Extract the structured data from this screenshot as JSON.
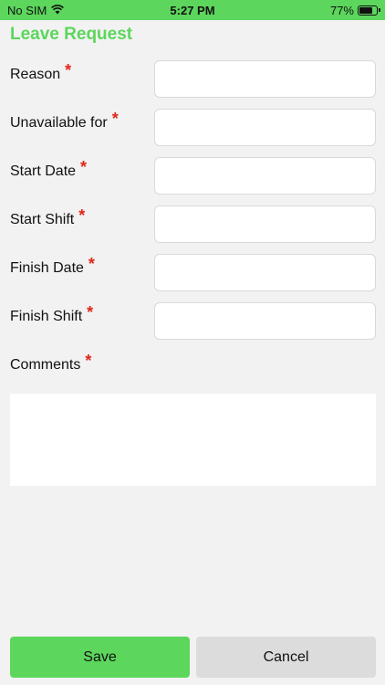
{
  "status_bar": {
    "carrier": "No SIM",
    "time": "5:27 PM",
    "battery_percent": "77%",
    "battery_level": 0.77,
    "wifi_icon": "wifi-icon",
    "battery_icon": "battery-icon"
  },
  "colors": {
    "accent": "#5cd65c",
    "required": "#e0251b",
    "cancel_bg": "#dcdcdc",
    "page_bg": "#f2f2f2"
  },
  "page": {
    "title": "Leave Request"
  },
  "form": {
    "required_marker": "*",
    "fields": [
      {
        "label": "Reason",
        "value": ""
      },
      {
        "label": "Unavailable for",
        "value": ""
      },
      {
        "label": "Start Date",
        "value": ""
      },
      {
        "label": "Start Shift",
        "value": ""
      },
      {
        "label": "Finish Date",
        "value": ""
      },
      {
        "label": "Finish Shift",
        "value": ""
      }
    ],
    "comments": {
      "label": "Comments",
      "value": ""
    }
  },
  "actions": {
    "save_label": "Save",
    "cancel_label": "Cancel"
  }
}
